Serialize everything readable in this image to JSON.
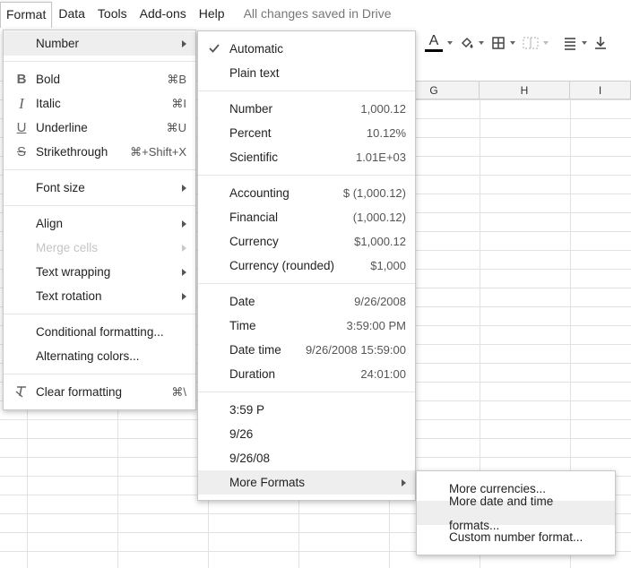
{
  "menubar": {
    "items": [
      "Format",
      "Data",
      "Tools",
      "Add-ons",
      "Help"
    ],
    "status": "All changes saved in Drive"
  },
  "toolbar": {
    "text_color_glyph": "A",
    "text_color_underline": "#000000",
    "icons": [
      "text-color-icon",
      "fill-color-icon",
      "borders-icon",
      "merge-cells-icon",
      "align-icon",
      "valign-icon"
    ]
  },
  "columns": [
    "G",
    "H",
    "I"
  ],
  "format_menu": {
    "number": "Number",
    "bold": "Bold",
    "bold_sc": "⌘B",
    "italic": "Italic",
    "italic_sc": "⌘I",
    "underline": "Underline",
    "underline_sc": "⌘U",
    "strike": "Strikethrough",
    "strike_sc": "⌘+Shift+X",
    "font_size": "Font size",
    "align": "Align",
    "merge": "Merge cells",
    "wrap": "Text wrapping",
    "rotation": "Text rotation",
    "conditional": "Conditional formatting...",
    "alternating": "Alternating colors...",
    "clear": "Clear formatting",
    "clear_sc": "⌘\\"
  },
  "number_menu": {
    "automatic": "Automatic",
    "plain": "Plain text",
    "number": "Number",
    "number_ex": "1,000.12",
    "percent": "Percent",
    "percent_ex": "10.12%",
    "scientific": "Scientific",
    "scientific_ex": "1.01E+03",
    "accounting": "Accounting",
    "accounting_ex": "$ (1,000.12)",
    "financial": "Financial",
    "financial_ex": "(1,000.12)",
    "currency": "Currency",
    "currency_ex": "$1,000.12",
    "currency_r": "Currency (rounded)",
    "currency_r_ex": "$1,000",
    "date": "Date",
    "date_ex": "9/26/2008",
    "time": "Time",
    "time_ex": "3:59:00 PM",
    "datetime": "Date time",
    "datetime_ex": "9/26/2008 15:59:00",
    "duration": "Duration",
    "duration_ex": "24:01:00",
    "custom1": "3:59 P",
    "custom2": "9/26",
    "custom3": "9/26/08",
    "more": "More Formats"
  },
  "more_menu": {
    "currencies": "More currencies...",
    "datetime": "More date and time formats...",
    "custom": "Custom number format..."
  }
}
